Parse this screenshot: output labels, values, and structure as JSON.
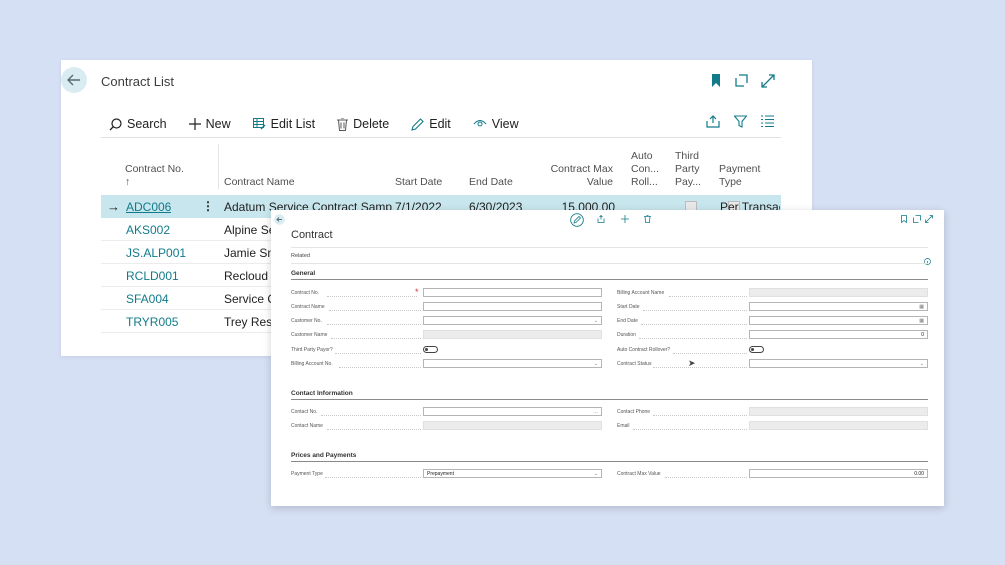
{
  "list": {
    "title": "Contract List",
    "toolbar": {
      "search": "Search",
      "new": "New",
      "edit_list": "Edit List",
      "delete": "Delete",
      "edit": "Edit",
      "view": "View"
    },
    "columns": {
      "no": "Contract No.",
      "sort_arrow": "↑",
      "name": "Contract Name",
      "start": "Start Date",
      "end": "End Date",
      "max_value_l1": "Contract Max",
      "max_value_l2": "Value",
      "auto_l1": "Auto",
      "auto_l2": "Con...",
      "auto_l3": "Roll...",
      "third_l1": "Third",
      "third_l2": "Party",
      "third_l3": "Pay...",
      "pay_l1": "Payment",
      "pay_l2": "Type"
    },
    "rows": [
      {
        "no": "ADC006",
        "name": "Adatum Service Contract Sample",
        "start": "7/1/2022",
        "end": "6/30/2023",
        "value": "15,000.00",
        "payment": "Per Transac"
      },
      {
        "no": "AKS002",
        "name": "Alpine Se",
        "start": "",
        "end": "",
        "value": "",
        "payment": ""
      },
      {
        "no": "JS.ALP001",
        "name": "Jamie Sm",
        "start": "",
        "end": "",
        "value": "",
        "payment": ""
      },
      {
        "no": "RCLD001",
        "name": "Recloud S",
        "start": "",
        "end": "",
        "value": "",
        "payment": ""
      },
      {
        "no": "SFA004",
        "name": "Service C",
        "start": "",
        "end": "",
        "value": "",
        "payment": ""
      },
      {
        "no": "TRYR005",
        "name": "Trey Rese",
        "start": "",
        "end": "",
        "value": "",
        "payment": ""
      }
    ]
  },
  "card": {
    "title": "Contract",
    "related": "Related",
    "sections": {
      "general": "General",
      "contact": "Contact Information",
      "prices": "Prices and Payments"
    },
    "fields": {
      "contract_no": {
        "label": "Contract No.",
        "value": ""
      },
      "contract_name": {
        "label": "Contract Name",
        "value": ""
      },
      "customer_no": {
        "label": "Customer No.",
        "value": ""
      },
      "customer_name": {
        "label": "Customer Name",
        "value": ""
      },
      "third_party": {
        "label": "Third Party Payor?"
      },
      "billing_account_no": {
        "label": "Billing Account No.",
        "value": ""
      },
      "billing_account_name": {
        "label": "Billing Account Name",
        "value": ""
      },
      "start_date": {
        "label": "Start Date",
        "value": ""
      },
      "end_date": {
        "label": "End Date",
        "value": ""
      },
      "duration": {
        "label": "Duration",
        "value": "0"
      },
      "auto_rollover": {
        "label": "Auto Contract Rollover?"
      },
      "contract_status": {
        "label": "Contract Status",
        "value": ""
      },
      "contact_no": {
        "label": "Contact No.",
        "value": ""
      },
      "contact_name": {
        "label": "Contact Name",
        "value": ""
      },
      "contact_phone": {
        "label": "Contact Phone",
        "value": ""
      },
      "email": {
        "label": "Email",
        "value": ""
      },
      "payment_type": {
        "label": "Payment Type",
        "value": "Prepayment"
      },
      "contract_max_value": {
        "label": "Contract Max Value",
        "value": "0.00"
      }
    }
  },
  "colors": {
    "accent": "#127b8a",
    "selected_row": "#c8e6ed",
    "background": "#d6e0f4"
  }
}
